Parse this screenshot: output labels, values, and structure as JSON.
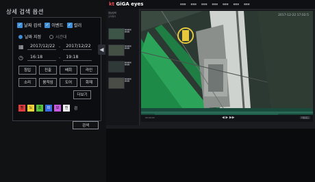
{
  "panel": {
    "title": "상세 검색 옵션",
    "checks": [
      {
        "label": "날짜 검색",
        "checked": true
      },
      {
        "label": "이벤트",
        "checked": true
      },
      {
        "label": "컬러",
        "checked": true
      }
    ],
    "radios": [
      {
        "label": "날짜 지정",
        "selected": true
      },
      {
        "label": "시간대",
        "selected": false
      }
    ],
    "date_start": "2017/12/22",
    "date_end": "2017/12/22",
    "date_sep": "-",
    "time_start": "16:18",
    "time_end": "19:18",
    "time_sep": "-",
    "events": [
      "침입",
      "진출",
      "배회",
      "라인",
      "소리",
      "움직임",
      "도어",
      "화재"
    ],
    "more_label": "더보기",
    "colors": [
      {
        "label": "빨",
        "hex": "#e23b3b"
      },
      {
        "label": "노",
        "hex": "#f0d13a"
      },
      {
        "label": "초",
        "hex": "#58c23a"
      },
      {
        "label": "파",
        "hex": "#3b6be2"
      },
      {
        "label": "보",
        "hex": "#c85ae0"
      },
      {
        "label": "흰",
        "hex": "#f2f2f2"
      }
    ],
    "colors_more": "검",
    "search_label": "검색"
  },
  "app": {
    "brand_prefix": "kt",
    "brand_name": "GiGA eyes",
    "timestamp": "2017-12-22 17:02:5",
    "sidebar_title": "영상검색",
    "sidebar_sub": "검색결과",
    "controls_time": "00:00:00",
    "controls_label": "다운로드"
  }
}
